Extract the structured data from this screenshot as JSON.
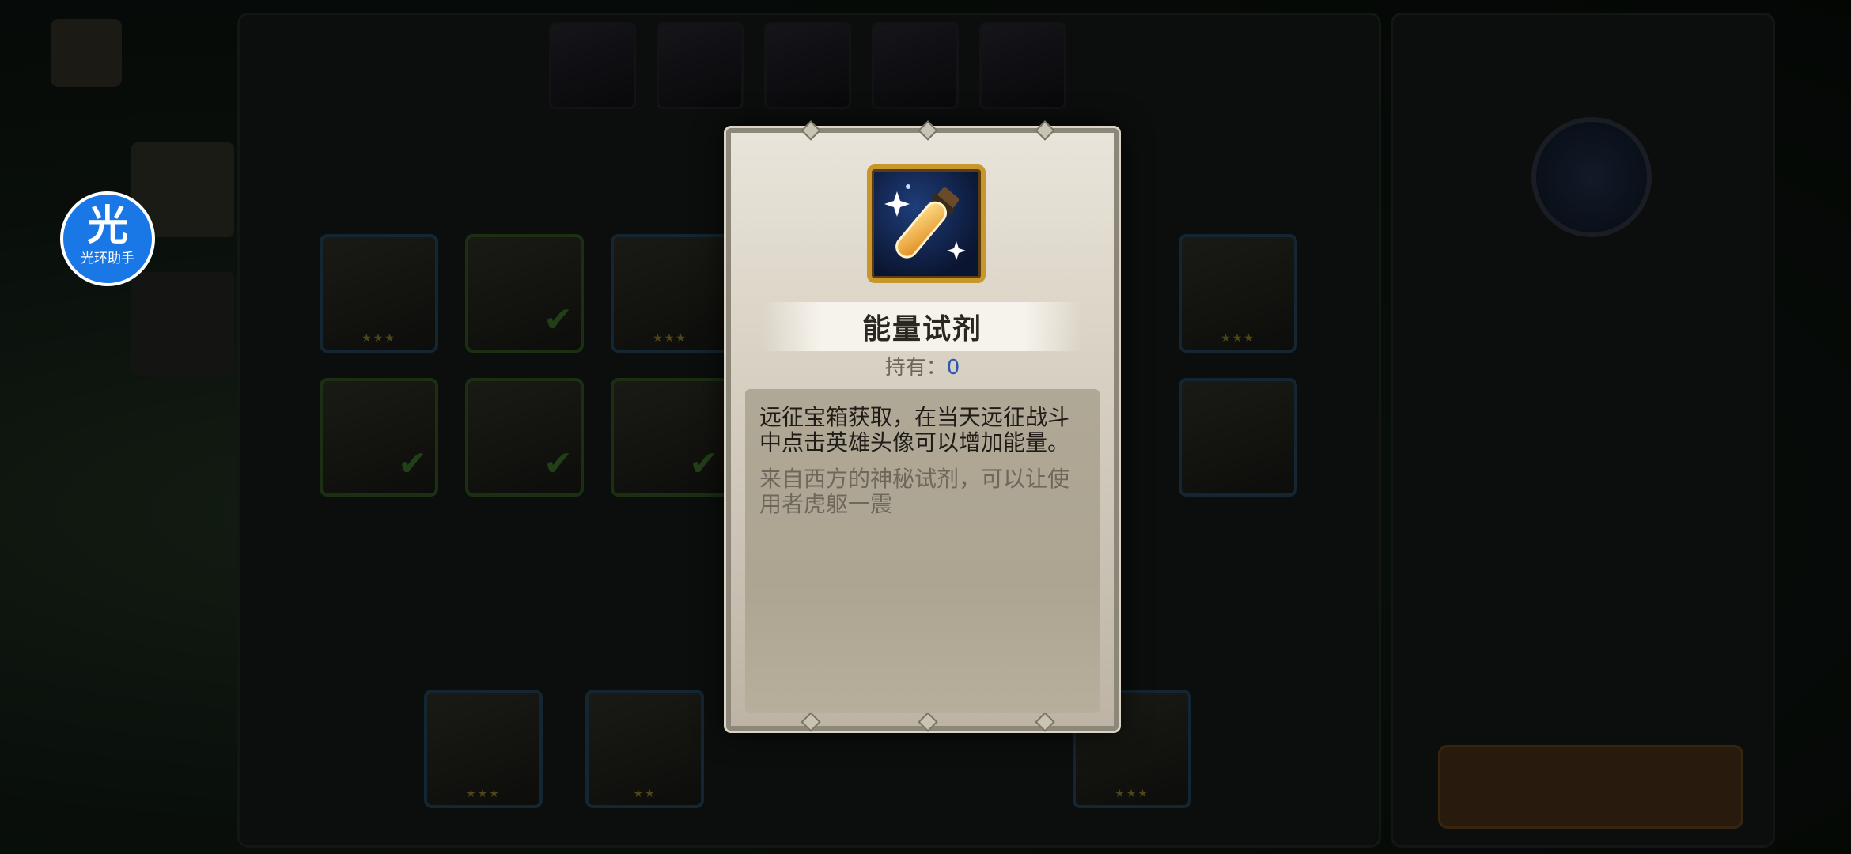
{
  "modal": {
    "item_name": "能量试剂",
    "owned_label": "持有：",
    "owned_count": "0",
    "description": "远征宝箱获取，在当天远征战斗中点击英雄头像可以增加能量。",
    "flavor_text": "来自西方的神秘试剂，可以让使用者虎躯一震",
    "icon": "potion-vial-icon"
  },
  "assistant": {
    "glyph": "光",
    "label": "光环助手"
  },
  "colors": {
    "owned_count": "#2d57b0",
    "icon_frame": "#c9962c",
    "assistant": "#1a78e6"
  }
}
